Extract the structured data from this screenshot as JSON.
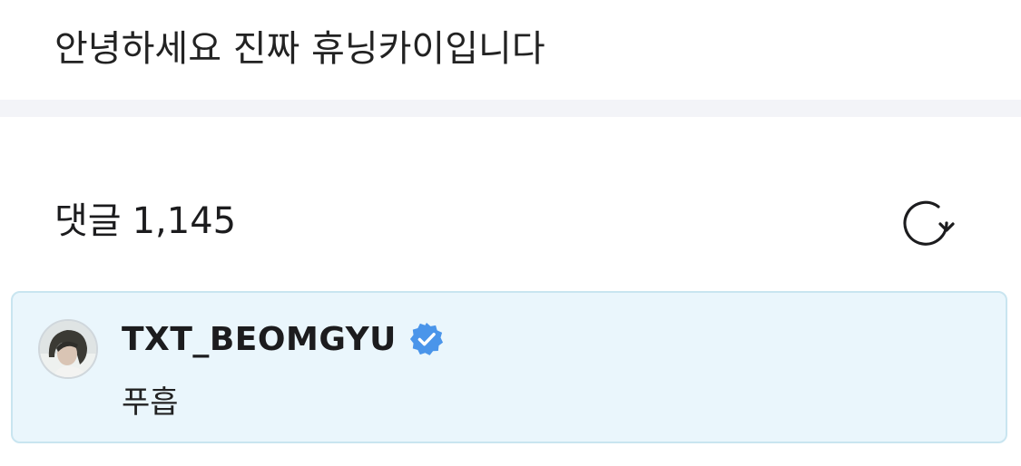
{
  "post": {
    "text": "안녕하세요 진짜 휴닝카이입니다"
  },
  "comments": {
    "label": "댓글",
    "count": "1,145",
    "refresh_icon": "refresh-icon"
  },
  "comment": {
    "author": "TXT_BEOMGYU",
    "verified_icon": "verified-badge-icon",
    "text": "푸흡"
  },
  "colors": {
    "divider": "#f3f4f8",
    "highlight_bg": "#eaf6fc",
    "highlight_border": "#c9e5f0",
    "verified": "#4a95ea"
  }
}
